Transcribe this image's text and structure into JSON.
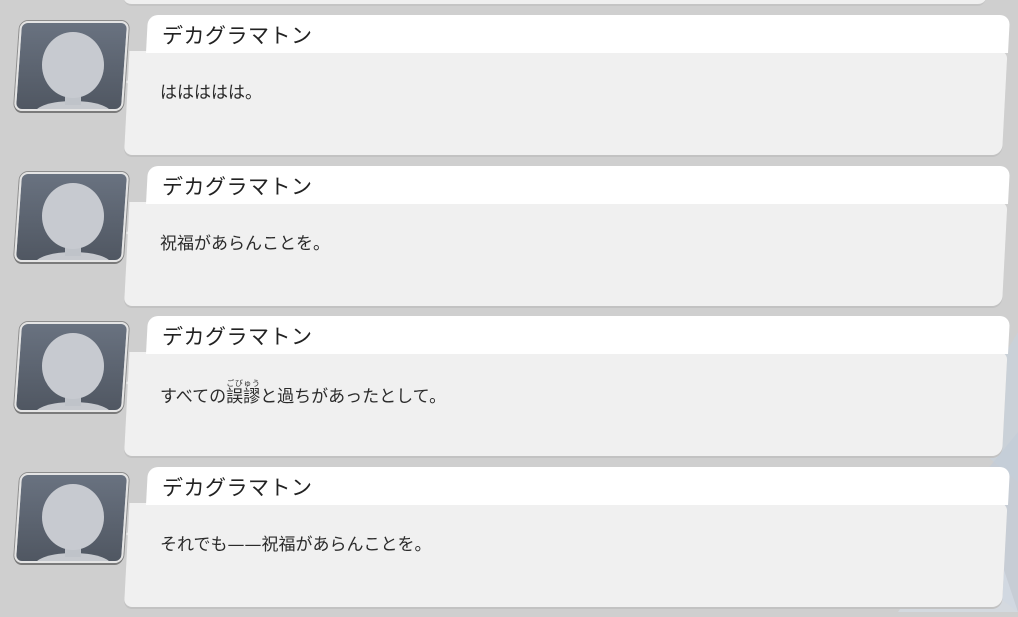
{
  "colors": {
    "background": "#cfcfcf",
    "name_bar": "#ffffff",
    "bubble": "#f0f0f0",
    "text": "#222222",
    "avatar": "#5f6672"
  },
  "entries": [
    {
      "speaker": "デカグラマトン",
      "avatar_icon": "default-avatar-icon",
      "message": "ははははは。"
    },
    {
      "speaker": "デカグラマトン",
      "avatar_icon": "default-avatar-icon",
      "message": "祝福があらんことを。"
    },
    {
      "speaker": "デカグラマトン",
      "avatar_icon": "default-avatar-icon",
      "message_before": "すべての",
      "message_ruby_base": "誤謬",
      "message_ruby_text": "ごびゅう",
      "message_after": "と過ちがあったとして。"
    },
    {
      "speaker": "デカグラマトン",
      "avatar_icon": "default-avatar-icon",
      "message": "それでも——祝福があらんことを。"
    }
  ]
}
